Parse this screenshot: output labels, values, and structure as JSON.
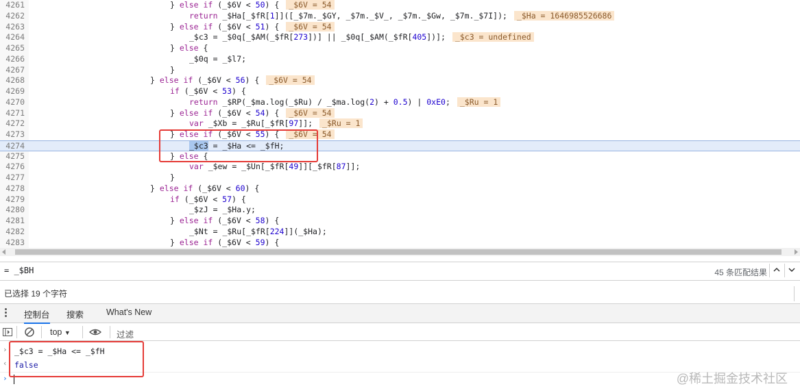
{
  "editor": {
    "lines": [
      {
        "num": "4261",
        "html": "} <span class='kw'>else if</span> (_$6V &lt; <span class='num'>50</span>) {",
        "inline": "_$6V = 54",
        "indent": 248
      },
      {
        "num": "4262",
        "html": "<span class='kw'>return</span> _$Ha[_$fR[<span class='num'>1</span>]]([_$7m._$GY, _$7m._$V_, _$7m._$Gw, _$7m._$7I]);",
        "inline": "_$Ha = 1646985526686",
        "indent": 276
      },
      {
        "num": "4263",
        "html": "} <span class='kw'>else if</span> (_$6V &lt; <span class='num'>51</span>) {",
        "inline": "_$6V = 54",
        "indent": 248
      },
      {
        "num": "4264",
        "html": "_$c3 = _$0q[_$AM(_$fR[<span class='num'>273</span>])] || _$0q[_$AM(_$fR[<span class='num'>405</span>])];",
        "inline": "_$c3 = undefined",
        "indent": 276
      },
      {
        "num": "4265",
        "html": "} <span class='kw'>else</span> {",
        "inline": "",
        "indent": 248
      },
      {
        "num": "4266",
        "html": "_$0q = _$l7;",
        "inline": "",
        "indent": 276
      },
      {
        "num": "4267",
        "html": "}",
        "inline": "",
        "indent": 248
      },
      {
        "num": "4268",
        "html": "} <span class='kw'>else if</span> (_$6V &lt; <span class='num'>56</span>) {",
        "inline": "_$6V = 54",
        "indent": 219
      },
      {
        "num": "4269",
        "html": "<span class='kw'>if</span> (_$6V &lt; <span class='num'>53</span>) {",
        "inline": "",
        "indent": 248
      },
      {
        "num": "4270",
        "html": "<span class='kw'>return</span> _$RP(_$ma.log(_$Ru) / _$ma.log(<span class='num'>2</span>) + <span class='num'>0.5</span>) | <span class='num'>0xE0</span>;",
        "inline": "_$Ru = 1",
        "indent": 276
      },
      {
        "num": "4271",
        "html": "} <span class='kw'>else if</span> (_$6V &lt; <span class='num'>54</span>) {",
        "inline": "_$6V = 54",
        "indent": 248
      },
      {
        "num": "4272",
        "html": "<span class='kw'>var</span> _$Xb = _$Ru[_$fR[<span class='num'>97</span>]];",
        "inline": "_$Ru = 1",
        "indent": 276
      },
      {
        "num": "4273",
        "html": "} <span class='kw'>else if</span> (_$6V &lt; <span class='num'>55</span>) {",
        "inline": "_$6V = 54",
        "indent": 248
      },
      {
        "num": "4274",
        "html": "<span class='sel'>_$c3</span> = _$Ha &lt;= _$fH;",
        "inline": "",
        "indent": 276,
        "highlight": true
      },
      {
        "num": "4275",
        "html": "} <span class='kw'>else</span> {",
        "inline": "",
        "indent": 248
      },
      {
        "num": "4276",
        "html": "<span class='kw'>var</span> _$ew = _$Un[_$fR[<span class='num'>49</span>]][_$fR[<span class='num'>87</span>]];",
        "inline": "",
        "indent": 276
      },
      {
        "num": "4277",
        "html": "}",
        "inline": "",
        "indent": 248
      },
      {
        "num": "4278",
        "html": "} <span class='kw'>else if</span> (_$6V &lt; <span class='num'>60</span>) {",
        "inline": "",
        "indent": 219
      },
      {
        "num": "4279",
        "html": "<span class='kw'>if</span> (_$6V &lt; <span class='num'>57</span>) {",
        "inline": "",
        "indent": 248
      },
      {
        "num": "4280",
        "html": "_$zJ = _$Ha.y;",
        "inline": "",
        "indent": 276
      },
      {
        "num": "4281",
        "html": "} <span class='kw'>else if</span> (_$6V &lt; <span class='num'>58</span>) {",
        "inline": "",
        "indent": 248
      },
      {
        "num": "4282",
        "html": "_$Nt = _$Ru[_$fR[<span class='num'>224</span>]](_$Ha);",
        "inline": "",
        "indent": 276
      },
      {
        "num": "4283",
        "html": "} <span class='kw'>else if</span> (_$6V &lt; <span class='num'>59</span>) {",
        "inline": "",
        "indent": 248
      }
    ]
  },
  "search": {
    "query": "= _$BH",
    "matches": "45 条匹配结果",
    "prev_icon": "chevron-up-icon",
    "next_icon": "chevron-down-icon"
  },
  "status": {
    "selection": "已选择 19 个字符"
  },
  "drawer": {
    "tabs": [
      {
        "label": "控制台",
        "active": true
      },
      {
        "label": "搜索",
        "active": false
      },
      {
        "label": "What's New",
        "active": false
      }
    ]
  },
  "toolbar": {
    "context": "top",
    "filter_placeholder": "过滤"
  },
  "console": {
    "input": "_$c3 = _$Ha <= _$fH",
    "result": "false",
    "input_prompt": "›",
    "result_prompt": "‹",
    "cursor_prompt": "›"
  },
  "watermark": "@稀土掘金技术社区",
  "colors": {
    "highlight_box": "#e53935",
    "active_tab": "#1a73e8",
    "inline_value_bg": "#fbe5cc"
  }
}
